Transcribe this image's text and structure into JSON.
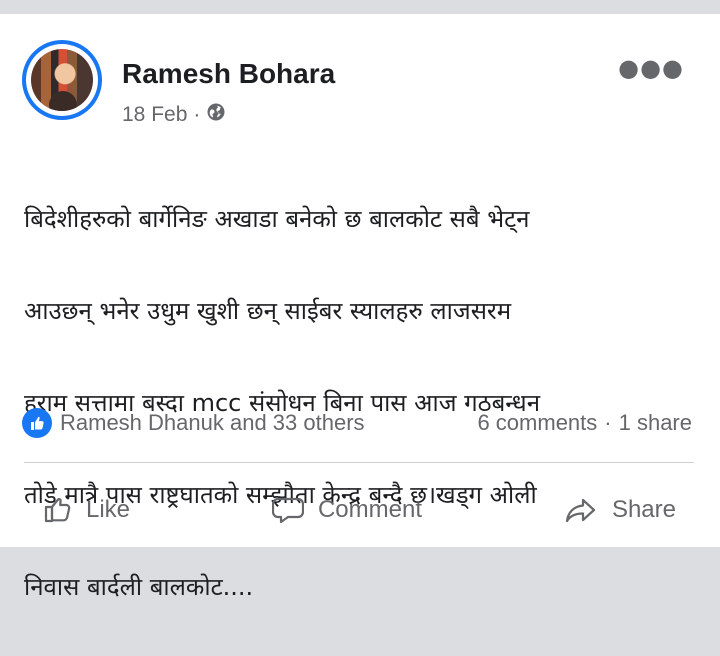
{
  "post": {
    "author": "Ramesh Bohara",
    "date": "18 Feb",
    "separator": "·",
    "privacy_icon": "globe-icon",
    "more_icon": "more-options-icon",
    "text_lines": [
      "बिदेशीहरुको बार्गेनिङ अखाडा बनेको छ बालकोट सबै भेट्न",
      "आउछन् भनेर उधुम खुशी छन् साईबर स्यालहरु लाजसरम",
      "हराम सत्तामा बस्दा mcc संसोधन बिना पास आज गठबन्धन",
      "तोडे मात्रै पास राष्ट्रघातको सम्झौता केन्द्र बन्दै छ।खड्ग ओली",
      "निवास बार्दली बालकोट...."
    ]
  },
  "stats": {
    "reactions_text": "Ramesh Dhanuk and 33 others",
    "comments_text": "6 comments",
    "dot": "·",
    "shares_text": "1 share"
  },
  "actions": {
    "like_label": "Like",
    "comment_label": "Comment",
    "share_label": "Share"
  },
  "colors": {
    "accent": "#1877f2",
    "text_primary": "#1c1e21",
    "text_secondary": "#65676b",
    "page_bg": "#dcdde1",
    "card_bg": "#ffffff"
  }
}
